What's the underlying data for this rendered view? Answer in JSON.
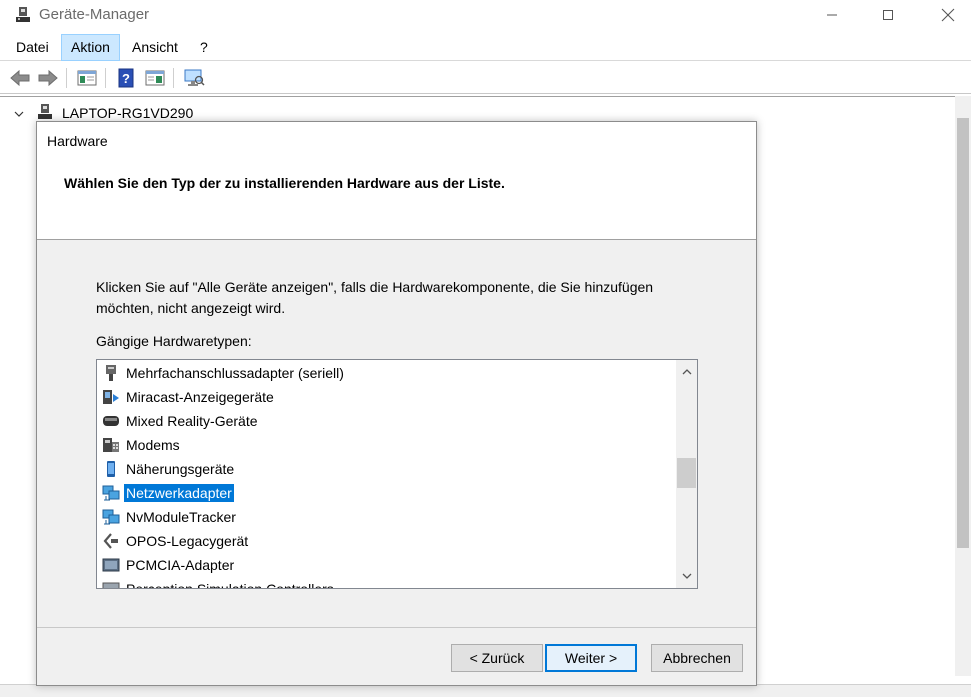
{
  "window": {
    "title": "Geräte-Manager",
    "icon": "device-manager-icon"
  },
  "menubar": {
    "items": [
      "Datei",
      "Aktion",
      "Ansicht",
      "?"
    ],
    "active": "Aktion"
  },
  "toolbar": {
    "icons": [
      "back-icon",
      "forward-icon",
      "show-hide-console-tree-icon",
      "help-icon",
      "properties-icon",
      "scan-hardware-icon"
    ]
  },
  "tree": {
    "root_label": "LAPTOP-RG1VD290",
    "expanded": true
  },
  "dialog": {
    "title": "Hardware",
    "heading": "Wählen Sie den Typ der zu installierenden Hardware aus der Liste.",
    "description": "Klicken Sie auf \"Alle Geräte anzeigen\", falls die Hardwarekomponente, die Sie hinzufügen möchten, nicht angezeigt wird.",
    "list_label": "Gängige Hardwaretypen:",
    "items": [
      {
        "label": "Mehrfachanschlussadapter (seriell)",
        "icon": "serial-adapter-icon"
      },
      {
        "label": "Miracast-Anzeigegeräte",
        "icon": "miracast-display-icon"
      },
      {
        "label": "Mixed Reality-Geräte",
        "icon": "mixed-reality-icon"
      },
      {
        "label": "Modems",
        "icon": "modem-icon"
      },
      {
        "label": "Näherungsgeräte",
        "icon": "proximity-device-icon"
      },
      {
        "label": "Netzwerkadapter",
        "icon": "network-adapter-icon"
      },
      {
        "label": "NvModuleTracker",
        "icon": "nv-module-tracker-icon"
      },
      {
        "label": "OPOS-Legacygerät",
        "icon": "opos-device-icon"
      },
      {
        "label": "PCMCIA-Adapter",
        "icon": "pcmcia-adapter-icon"
      },
      {
        "label": "Perception Simulation Controllers",
        "icon": "perception-controller-icon"
      }
    ],
    "selected": "Netzwerkadapter",
    "buttons": {
      "back": "< Zurück",
      "next": "Weiter >",
      "cancel": "Abbrechen"
    }
  }
}
